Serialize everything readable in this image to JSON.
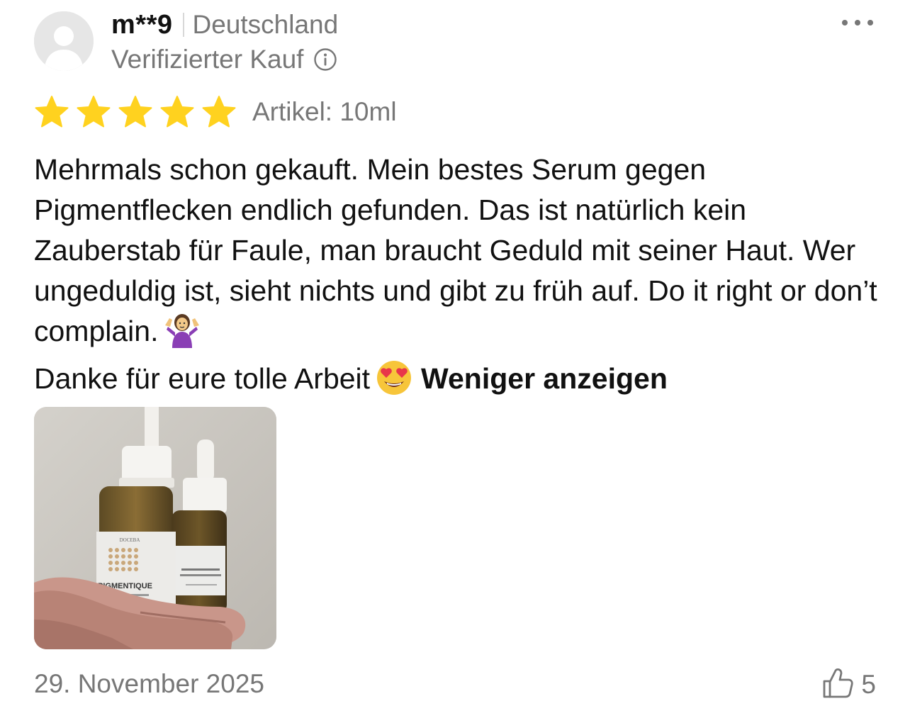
{
  "review": {
    "username": "m**9",
    "country": "Deutschland",
    "verified_label": "Verifizierter Kauf",
    "rating": 5,
    "max_rating": 5,
    "variant": "Artikel: 10ml",
    "text_part1": "Mehrmals schon gekauft. Mein bestes Serum gegen Pigmentflecken endlich gefunden. Das ist natürlich kein Zauberstab für Faule, man braucht Geduld mit seiner Haut. Wer ungeduldig ist, sieht nichts und gibt zu früh auf. Do it right or don’t complain.",
    "text_part2": "Danke für eure tolle Arbeit",
    "show_less_label": "Weniger anzeigen",
    "photo_labels": {
      "brand": "DOCEBA",
      "product": "PIGMENTIQUE"
    },
    "date": "29. November 2025",
    "helpful_count": "5"
  },
  "icons": {
    "avatar": "user-avatar-placeholder",
    "info": "info-circle-icon",
    "more": "more-dots-icon",
    "star": "star-icon",
    "thumbs_up": "thumbs-up-icon",
    "emoji_shrug": "person-shrugging-emoji",
    "emoji_heart_eyes": "heart-eyes-emoji"
  },
  "colors": {
    "star": "#FFD21F",
    "muted_text": "#777777",
    "primary_text": "#111111"
  }
}
